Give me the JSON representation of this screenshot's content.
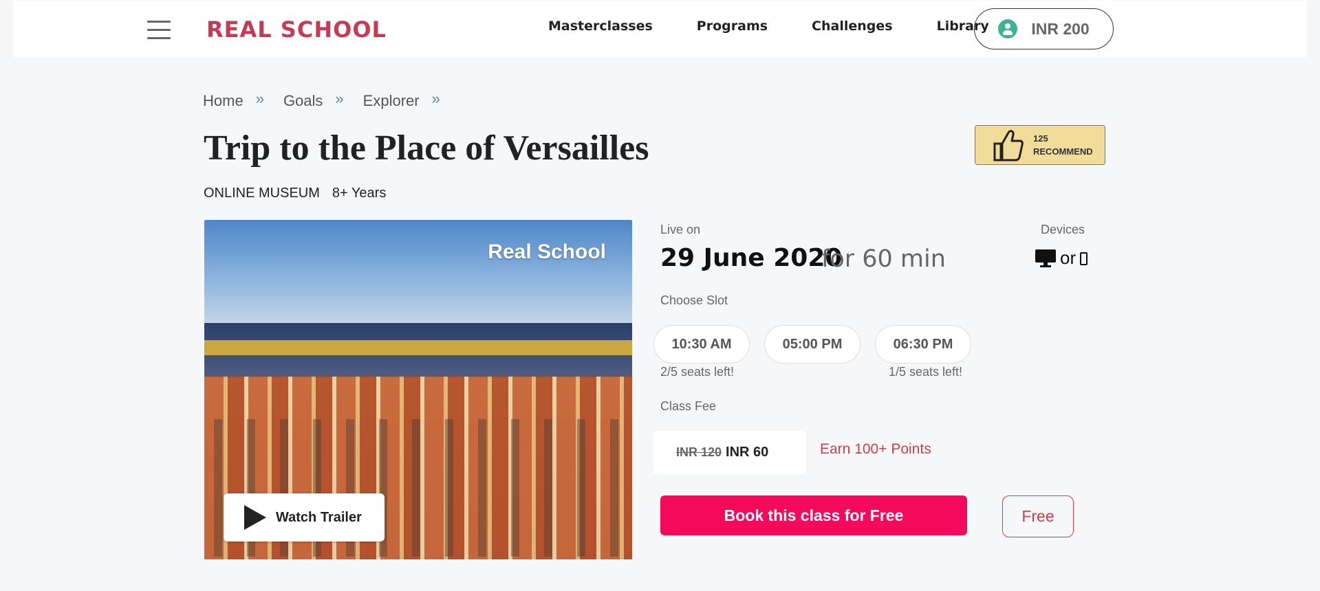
{
  "header": {
    "logo": "REAL SCHOOL",
    "nav": [
      "Masterclasses",
      "Programs",
      "Challenges",
      "Library"
    ],
    "wallet": "INR 200"
  },
  "breadcrumb": [
    "Home",
    "Goals",
    "Explorer"
  ],
  "breadcrumb_separator": "»",
  "page": {
    "title": "Trip to the Place of Versailles",
    "category": "ONLINE MUSEUM",
    "age": "8+ Years"
  },
  "recommend": {
    "count": "125",
    "label": "RECOMMEND"
  },
  "hero": {
    "brand": "Real School",
    "trailer_label": "Watch Trailer"
  },
  "details": {
    "live_label": "Live on",
    "date": "29 June 2020",
    "duration": "for 60 min",
    "devices_label": "Devices",
    "devices_or": "or",
    "slot_label": "Choose Slot",
    "slots": [
      {
        "time": "10:30 AM",
        "seats": "2/5 seats left!"
      },
      {
        "time": "05:00 PM",
        "seats": ""
      },
      {
        "time": "06:30 PM",
        "seats": "1/5 seats left!"
      }
    ],
    "fee_label": "Class Fee",
    "fee_old": "INR 120",
    "fee_new": "INR 60",
    "points": "Earn 100+ Points",
    "book_label": "Book this class for Free",
    "free_label": "Free"
  },
  "colors": {
    "brand": "#c73a56",
    "book_button": "#f50a5b",
    "accent_red": "#d23d4a",
    "recommend_bg": "#f1dc9a",
    "avatar": "#3bb394"
  }
}
